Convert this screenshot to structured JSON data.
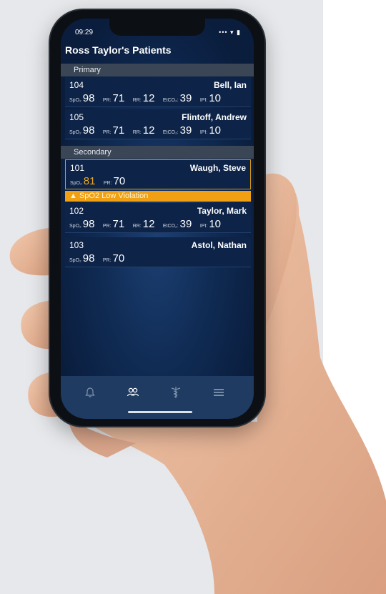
{
  "status_bar": {
    "time": "09:29",
    "signal_icons": "••• ▾ ▮"
  },
  "header": {
    "title": "Ross Taylor's Patients"
  },
  "sections": {
    "primary": "Primary",
    "secondary": "Secondary"
  },
  "patients": [
    {
      "room": "104",
      "name": "Bell, Ian",
      "vitals": [
        {
          "label": "SpO₂",
          "value": "98"
        },
        {
          "label": "PR:",
          "value": "71"
        },
        {
          "label": "RR:",
          "value": "12"
        },
        {
          "label": "EtCO₂:",
          "value": "39"
        },
        {
          "label": "IPI:",
          "value": "10"
        }
      ]
    },
    {
      "room": "105",
      "name": "Flintoff, Andrew",
      "vitals": [
        {
          "label": "SpO₂",
          "value": "98"
        },
        {
          "label": "PR:",
          "value": "71"
        },
        {
          "label": "RR:",
          "value": "12"
        },
        {
          "label": "EtCO₂:",
          "value": "39"
        },
        {
          "label": "IPI:",
          "value": "10"
        }
      ]
    },
    {
      "room": "101",
      "name": "Waugh, Steve",
      "vitals": [
        {
          "label": "SpO₂",
          "value": "81"
        },
        {
          "label": "PR:",
          "value": "70"
        }
      ],
      "alert": "▲  SpO2 Low Violation"
    },
    {
      "room": "102",
      "name": "Taylor, Mark",
      "vitals": [
        {
          "label": "SpO₂",
          "value": "98"
        },
        {
          "label": "PR:",
          "value": "71"
        },
        {
          "label": "RR:",
          "value": "12"
        },
        {
          "label": "EtCO₂:",
          "value": "39"
        },
        {
          "label": "IPI:",
          "value": "10"
        }
      ]
    },
    {
      "room": "103",
      "name": "Astol, Nathan",
      "vitals": [
        {
          "label": "SpO₂",
          "value": "98"
        },
        {
          "label": "PR:",
          "value": "70"
        }
      ]
    }
  ],
  "tabs": [
    {
      "icon": "bell-icon"
    },
    {
      "icon": "patients-icon"
    },
    {
      "icon": "caduceus-icon"
    },
    {
      "icon": "menu-icon"
    }
  ],
  "colors": {
    "alert": "#f0a012",
    "background": "#0f2a52",
    "tab_bar": "#1f3b62"
  }
}
